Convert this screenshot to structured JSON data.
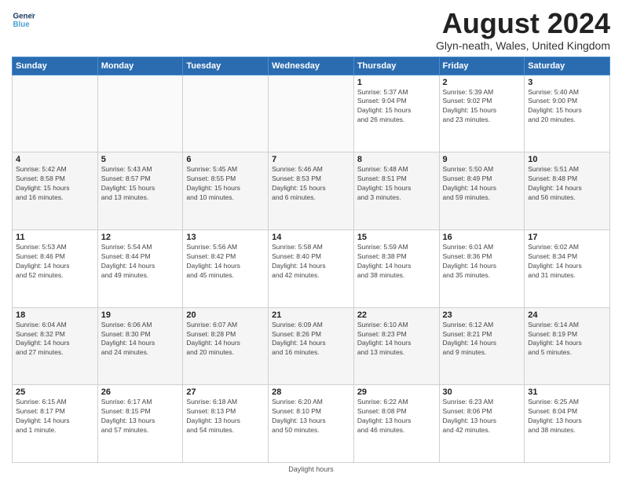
{
  "header": {
    "logo_line1": "General",
    "logo_line2": "Blue",
    "month_year": "August 2024",
    "location": "Glyn-neath, Wales, United Kingdom"
  },
  "days_of_week": [
    "Sunday",
    "Monday",
    "Tuesday",
    "Wednesday",
    "Thursday",
    "Friday",
    "Saturday"
  ],
  "weeks": [
    [
      {
        "day": "",
        "info": ""
      },
      {
        "day": "",
        "info": ""
      },
      {
        "day": "",
        "info": ""
      },
      {
        "day": "",
        "info": ""
      },
      {
        "day": "1",
        "info": "Sunrise: 5:37 AM\nSunset: 9:04 PM\nDaylight: 15 hours\nand 26 minutes."
      },
      {
        "day": "2",
        "info": "Sunrise: 5:39 AM\nSunset: 9:02 PM\nDaylight: 15 hours\nand 23 minutes."
      },
      {
        "day": "3",
        "info": "Sunrise: 5:40 AM\nSunset: 9:00 PM\nDaylight: 15 hours\nand 20 minutes."
      }
    ],
    [
      {
        "day": "4",
        "info": "Sunrise: 5:42 AM\nSunset: 8:58 PM\nDaylight: 15 hours\nand 16 minutes."
      },
      {
        "day": "5",
        "info": "Sunrise: 5:43 AM\nSunset: 8:57 PM\nDaylight: 15 hours\nand 13 minutes."
      },
      {
        "day": "6",
        "info": "Sunrise: 5:45 AM\nSunset: 8:55 PM\nDaylight: 15 hours\nand 10 minutes."
      },
      {
        "day": "7",
        "info": "Sunrise: 5:46 AM\nSunset: 8:53 PM\nDaylight: 15 hours\nand 6 minutes."
      },
      {
        "day": "8",
        "info": "Sunrise: 5:48 AM\nSunset: 8:51 PM\nDaylight: 15 hours\nand 3 minutes."
      },
      {
        "day": "9",
        "info": "Sunrise: 5:50 AM\nSunset: 8:49 PM\nDaylight: 14 hours\nand 59 minutes."
      },
      {
        "day": "10",
        "info": "Sunrise: 5:51 AM\nSunset: 8:48 PM\nDaylight: 14 hours\nand 56 minutes."
      }
    ],
    [
      {
        "day": "11",
        "info": "Sunrise: 5:53 AM\nSunset: 8:46 PM\nDaylight: 14 hours\nand 52 minutes."
      },
      {
        "day": "12",
        "info": "Sunrise: 5:54 AM\nSunset: 8:44 PM\nDaylight: 14 hours\nand 49 minutes."
      },
      {
        "day": "13",
        "info": "Sunrise: 5:56 AM\nSunset: 8:42 PM\nDaylight: 14 hours\nand 45 minutes."
      },
      {
        "day": "14",
        "info": "Sunrise: 5:58 AM\nSunset: 8:40 PM\nDaylight: 14 hours\nand 42 minutes."
      },
      {
        "day": "15",
        "info": "Sunrise: 5:59 AM\nSunset: 8:38 PM\nDaylight: 14 hours\nand 38 minutes."
      },
      {
        "day": "16",
        "info": "Sunrise: 6:01 AM\nSunset: 8:36 PM\nDaylight: 14 hours\nand 35 minutes."
      },
      {
        "day": "17",
        "info": "Sunrise: 6:02 AM\nSunset: 8:34 PM\nDaylight: 14 hours\nand 31 minutes."
      }
    ],
    [
      {
        "day": "18",
        "info": "Sunrise: 6:04 AM\nSunset: 8:32 PM\nDaylight: 14 hours\nand 27 minutes."
      },
      {
        "day": "19",
        "info": "Sunrise: 6:06 AM\nSunset: 8:30 PM\nDaylight: 14 hours\nand 24 minutes."
      },
      {
        "day": "20",
        "info": "Sunrise: 6:07 AM\nSunset: 8:28 PM\nDaylight: 14 hours\nand 20 minutes."
      },
      {
        "day": "21",
        "info": "Sunrise: 6:09 AM\nSunset: 8:26 PM\nDaylight: 14 hours\nand 16 minutes."
      },
      {
        "day": "22",
        "info": "Sunrise: 6:10 AM\nSunset: 8:23 PM\nDaylight: 14 hours\nand 13 minutes."
      },
      {
        "day": "23",
        "info": "Sunrise: 6:12 AM\nSunset: 8:21 PM\nDaylight: 14 hours\nand 9 minutes."
      },
      {
        "day": "24",
        "info": "Sunrise: 6:14 AM\nSunset: 8:19 PM\nDaylight: 14 hours\nand 5 minutes."
      }
    ],
    [
      {
        "day": "25",
        "info": "Sunrise: 6:15 AM\nSunset: 8:17 PM\nDaylight: 14 hours\nand 1 minute."
      },
      {
        "day": "26",
        "info": "Sunrise: 6:17 AM\nSunset: 8:15 PM\nDaylight: 13 hours\nand 57 minutes."
      },
      {
        "day": "27",
        "info": "Sunrise: 6:18 AM\nSunset: 8:13 PM\nDaylight: 13 hours\nand 54 minutes."
      },
      {
        "day": "28",
        "info": "Sunrise: 6:20 AM\nSunset: 8:10 PM\nDaylight: 13 hours\nand 50 minutes."
      },
      {
        "day": "29",
        "info": "Sunrise: 6:22 AM\nSunset: 8:08 PM\nDaylight: 13 hours\nand 46 minutes."
      },
      {
        "day": "30",
        "info": "Sunrise: 6:23 AM\nSunset: 8:06 PM\nDaylight: 13 hours\nand 42 minutes."
      },
      {
        "day": "31",
        "info": "Sunrise: 6:25 AM\nSunset: 8:04 PM\nDaylight: 13 hours\nand 38 minutes."
      }
    ]
  ],
  "footer": "Daylight hours"
}
